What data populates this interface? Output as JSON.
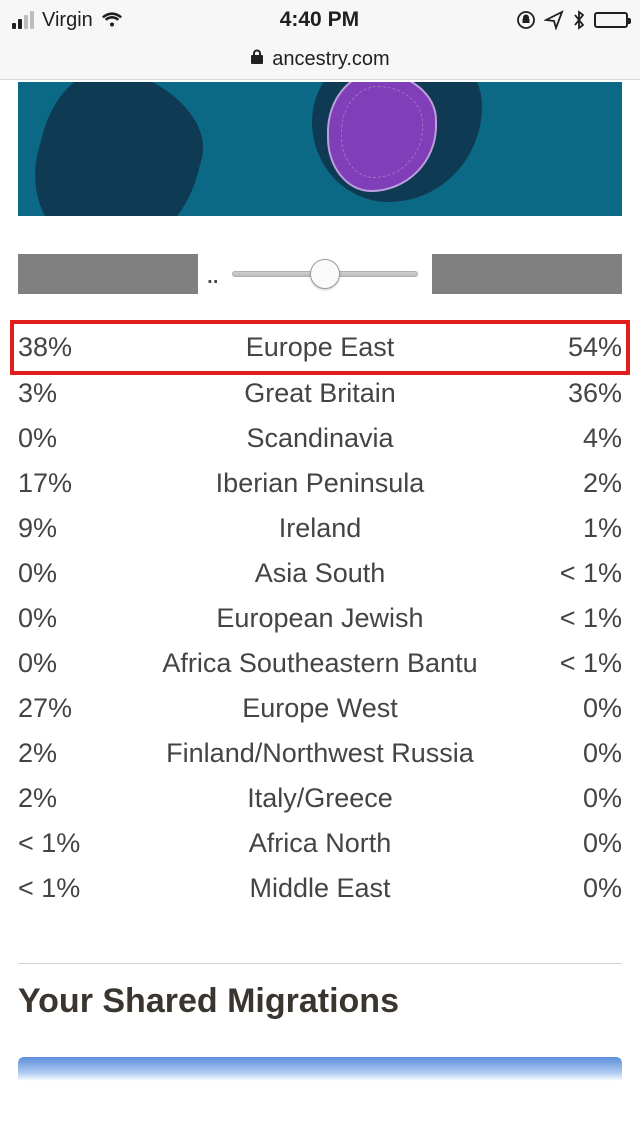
{
  "statusbar": {
    "carrier": "Virgin",
    "time": "4:40 PM"
  },
  "urlbar": {
    "domain": "ancestry.com"
  },
  "comparator": {
    "ellipsis": ".."
  },
  "ethnicity_rows": [
    {
      "left": "38%",
      "region": "Europe East",
      "right": "54%",
      "highlight": true
    },
    {
      "left": "3%",
      "region": "Great Britain",
      "right": "36%",
      "highlight": false
    },
    {
      "left": "0%",
      "region": "Scandinavia",
      "right": "4%",
      "highlight": false
    },
    {
      "left": "17%",
      "region": "Iberian Peninsula",
      "right": "2%",
      "highlight": false
    },
    {
      "left": "9%",
      "region": "Ireland",
      "right": "1%",
      "highlight": false
    },
    {
      "left": "0%",
      "region": "Asia South",
      "right": "< 1%",
      "highlight": false
    },
    {
      "left": "0%",
      "region": "European Jewish",
      "right": "< 1%",
      "highlight": false
    },
    {
      "left": "0%",
      "region": "Africa Southeastern Bantu",
      "right": "< 1%",
      "highlight": false
    },
    {
      "left": "27%",
      "region": "Europe West",
      "right": "0%",
      "highlight": false
    },
    {
      "left": "2%",
      "region": "Finland/Northwest Russia",
      "right": "0%",
      "highlight": false
    },
    {
      "left": "2%",
      "region": "Italy/Greece",
      "right": "0%",
      "highlight": false
    },
    {
      "left": "< 1%",
      "region": "Africa North",
      "right": "0%",
      "highlight": false
    },
    {
      "left": "< 1%",
      "region": "Middle East",
      "right": "0%",
      "highlight": false
    }
  ],
  "sections": {
    "shared_migrations_title": "Your Shared Migrations"
  }
}
